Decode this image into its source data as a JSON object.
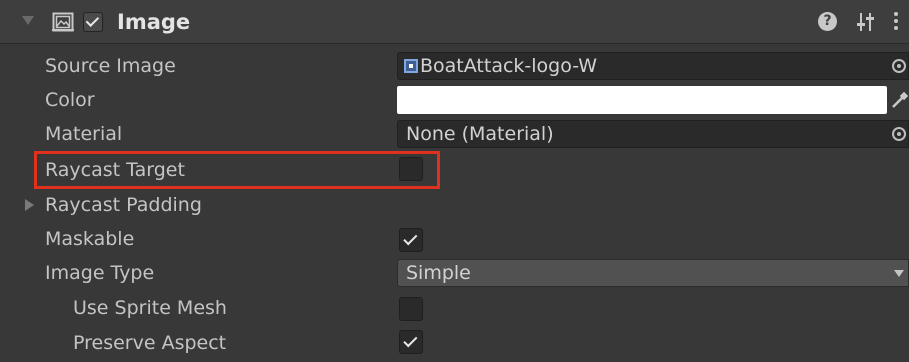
{
  "component": {
    "title": "Image",
    "enabled": true
  },
  "fields": {
    "source_image": {
      "label": "Source Image",
      "value": "BoatAttack-logo-W"
    },
    "color": {
      "label": "Color",
      "value": "#ffffff"
    },
    "material": {
      "label": "Material",
      "value": "None (Material)"
    },
    "raycast_target": {
      "label": "Raycast Target",
      "checked": false
    },
    "raycast_padding": {
      "label": "Raycast Padding",
      "expanded": false
    },
    "maskable": {
      "label": "Maskable",
      "checked": true
    },
    "image_type": {
      "label": "Image Type",
      "value": "Simple"
    },
    "use_sprite_mesh": {
      "label": "Use Sprite Mesh",
      "checked": false
    },
    "preserve_aspect": {
      "label": "Preserve Aspect",
      "checked": true
    }
  },
  "icons": {
    "foldout": "triangle-down-icon",
    "component": "image-component-icon",
    "help": "help-icon",
    "presets": "presets-icon",
    "menu": "kebab-menu-icon",
    "object_picker": "object-picker-icon",
    "eyedropper": "eyedropper-icon",
    "dropdown": "chevron-down-icon"
  },
  "colors": {
    "background": "#383838",
    "header": "#3e3e3e",
    "highlight": "#e0301e",
    "color_swatch": "#ffffff"
  }
}
